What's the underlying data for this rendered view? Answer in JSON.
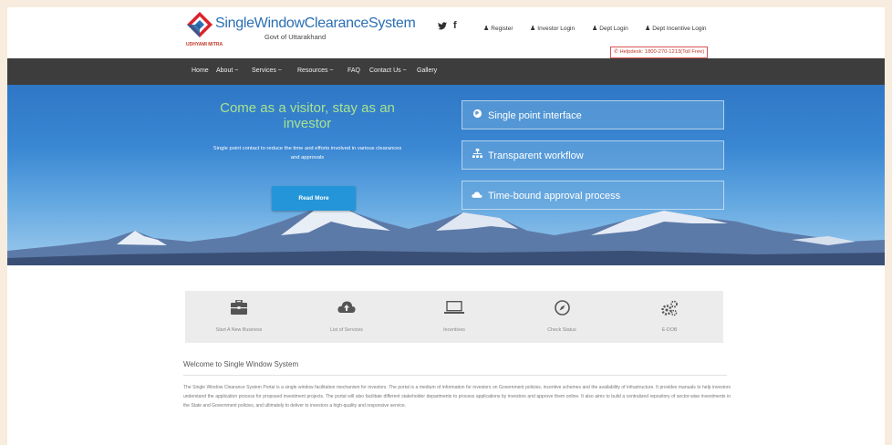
{
  "header": {
    "logo_title": "SingleWindowClearanceSystem",
    "logo_subtitle": "Govt of Uttarakhand",
    "logo_tag": "UDHYAMI MITRA",
    "social": [
      {
        "icon": "twitter-icon",
        "glyph": "🐦"
      },
      {
        "icon": "facebook-icon",
        "glyph": "f"
      }
    ],
    "top_links": [
      {
        "label": "Register",
        "icon": "user-icon"
      },
      {
        "label": "Investor Login",
        "icon": "user-icon"
      },
      {
        "label": "Dept Login",
        "icon": "user-icon"
      },
      {
        "label": "Dept Incentive Login",
        "icon": "user-icon"
      }
    ],
    "helpdesk": "Helpdesk: 1800-270-1213(Toll Free)"
  },
  "nav": {
    "items": [
      "Home",
      "About ~",
      "Services ~",
      "Resources ~",
      "FAQ",
      "Contact Us ~",
      "Gallery"
    ]
  },
  "hero": {
    "title": "Come as a visitor, stay as an investor",
    "description": "Single point contact to reduce the time and efforts involved in various clearances and approvals",
    "button": "Read More",
    "features": [
      {
        "label": "Single point interface",
        "icon": "globe-icon",
        "glyph": "●"
      },
      {
        "label": "Transparent workflow",
        "icon": "sitemap-icon",
        "glyph": "⁂"
      },
      {
        "label": "Time-bound approval process",
        "icon": "cloud-icon",
        "glyph": "☁"
      }
    ]
  },
  "tiles": [
    {
      "label": "Start A New Business",
      "icon": "briefcase-icon",
      "glyph": "💼"
    },
    {
      "label": "List of Services",
      "icon": "cloud-upload-icon",
      "glyph": "☁"
    },
    {
      "label": "Incentives",
      "icon": "laptop-icon",
      "glyph": "💻"
    },
    {
      "label": "Check Status",
      "icon": "compass-icon",
      "glyph": "◎"
    },
    {
      "label": "E-DOB",
      "icon": "gears-icon",
      "glyph": "⚙"
    }
  ],
  "welcome": {
    "title": "Welcome to Single Window System",
    "text": "The Single Window Clearance System Portal is a single window facilitation mechanism for investors. The portal is a medium of information for investors on Government policies, incentive schemes and the availability of infrastructure. It provides manuals to help investors understand the application process for proposed investment projects. The portal will also facilitate different stakeholder departments to process applications by investors and approve them online. It also aims to build a centralized repository of sector-wise investments in the State and Government policies, and ultimately to deliver to investors a high-quality and responsive service."
  },
  "colors": {
    "brand_blue": "#2b6fb4",
    "nav_bg": "#3d3d3d",
    "hero_title": "#a7e38f",
    "button": "#2495d8",
    "helpdesk_red": "#c0392b"
  }
}
